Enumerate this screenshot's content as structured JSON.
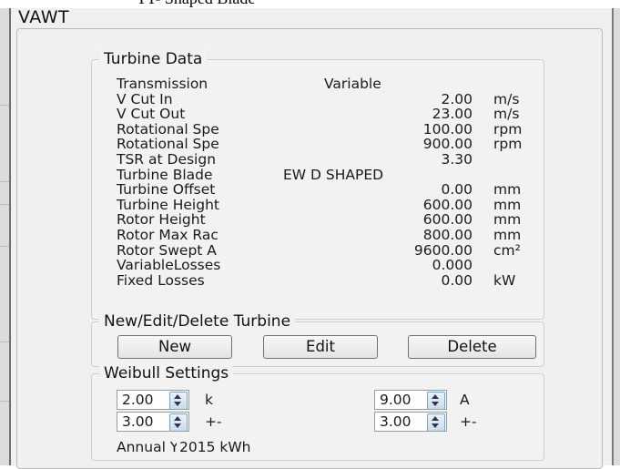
{
  "top_caption": "TT- Shaped Blade",
  "window": {
    "title": "VAWT"
  },
  "turbine_data": {
    "title": "Turbine Data",
    "rows": [
      {
        "label": "Transmission",
        "value": "Variable",
        "unit": ""
      },
      {
        "label": "V Cut In",
        "value": "2.00",
        "unit": "m/s"
      },
      {
        "label": "V Cut Out",
        "value": "23.00",
        "unit": "m/s"
      },
      {
        "label": "Rotational Spe",
        "value": "100.00",
        "unit": "rpm"
      },
      {
        "label": "Rotational Spe",
        "value": "900.00",
        "unit": "rpm"
      },
      {
        "label": "TSR at Design",
        "value": "3.30",
        "unit": ""
      },
      {
        "label": "Turbine Blade",
        "value": "EW D SHAPED",
        "unit": ""
      },
      {
        "label": "Turbine Offset",
        "value": "0.00",
        "unit": "mm"
      },
      {
        "label": "Turbine Height",
        "value": "600.00",
        "unit": "mm"
      },
      {
        "label": "Rotor Height",
        "value": "600.00",
        "unit": "mm"
      },
      {
        "label": "Rotor Max Rac",
        "value": "800.00",
        "unit": "mm"
      },
      {
        "label": "Rotor Swept A",
        "value": "9600.00",
        "unit": "cm²"
      },
      {
        "label": "VariableLosses",
        "value": "0.000",
        "unit": ""
      },
      {
        "label": "Fixed Losses",
        "value": "0.00",
        "unit": "kW"
      }
    ]
  },
  "edit_turbine": {
    "title": "New/Edit/Delete Turbine",
    "new_label": "New",
    "edit_label": "Edit",
    "delete_label": "Delete"
  },
  "weibull": {
    "title": "Weibull Settings",
    "k_value": "2.00",
    "k_label": "k",
    "k_pm_value": "3.00",
    "k_pm_label": "+-",
    "a_value": "9.00",
    "a_label": "A",
    "a_pm_value": "3.00",
    "a_pm_label": "+-",
    "annual_yield_label": "Annual Yie",
    "annual_yield_value": "2015 kWh"
  }
}
